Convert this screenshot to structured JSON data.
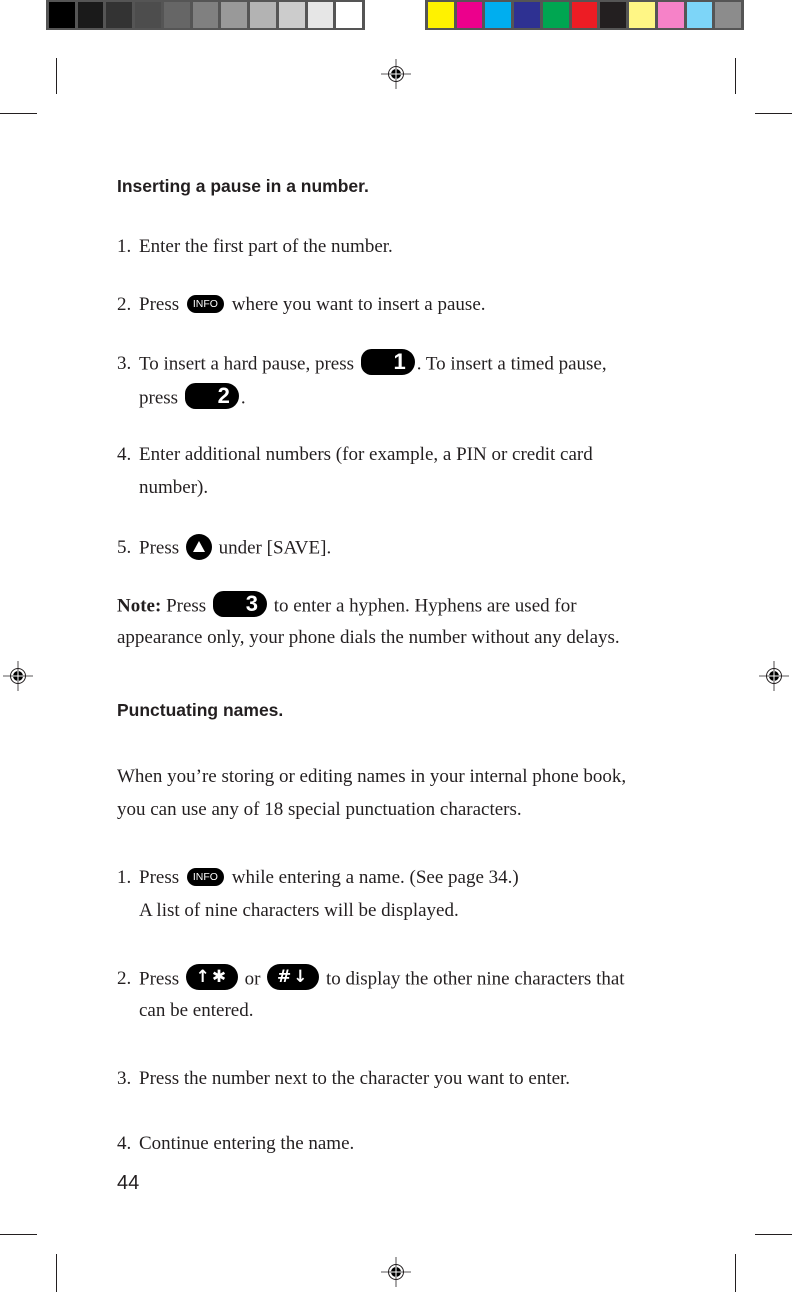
{
  "color_bars": {
    "grayscale": [
      "#000000",
      "#1a1a1a",
      "#333333",
      "#4d4d4d",
      "#666666",
      "#808080",
      "#999999",
      "#b3b3b3",
      "#cccccc",
      "#e6e6e6",
      "#ffffff"
    ],
    "process": [
      "#fff200",
      "#ec008c",
      "#00aeef",
      "#2e3192",
      "#00a651",
      "#ed1c24",
      "#231f20",
      "#fff685",
      "#f682c8",
      "#7dd5f8",
      "#8c8c8c"
    ]
  },
  "icons": {
    "registration_mark": "registration-mark",
    "info_key": "INFO",
    "key_1": "1",
    "key_2": "2",
    "key_3": "3",
    "up_softkey": "up-triangle",
    "star_key": "↑✱",
    "pound_key": "#↓"
  },
  "section1": {
    "heading": "Inserting a pause in a number.",
    "steps": [
      {
        "num": "1.",
        "text": "Enter the first part of the number."
      },
      {
        "num": "2.",
        "pre": "Press",
        "post": "where you want to insert a pause."
      },
      {
        "num": "3.",
        "pre": "To insert a hard pause, press",
        "mid": ". To insert a timed pause,",
        "line2_pre": "press",
        "line2_post": "."
      },
      {
        "num": "4.",
        "text": "Enter additional numbers (for example, a PIN or credit card",
        "line2": "number)."
      },
      {
        "num": "5.",
        "pre": "Press",
        "post": "under [SAVE]."
      }
    ],
    "note": {
      "label": "Note:",
      "pre": "Press",
      "post": "to enter a hyphen. Hyphens are used for",
      "line2": "appearance only, your phone dials the number without any delays."
    }
  },
  "section2": {
    "heading": "Punctuating names.",
    "intro_line1": "When you’re storing or editing names in your internal phone book,",
    "intro_line2": "you can use any of 18 special punctuation characters.",
    "steps": [
      {
        "num": "1.",
        "pre": "Press",
        "post": "while entering a name. (See page 34.)",
        "line2": "A list of nine characters will be displayed."
      },
      {
        "num": "2.",
        "pre": "Press",
        "mid": "or",
        "post": "to display the other nine characters that",
        "line2": "can be entered."
      },
      {
        "num": "3.",
        "text": "Press the number next to the character you want to enter."
      },
      {
        "num": "4.",
        "text": "Continue entering the name."
      }
    ]
  },
  "page_number": "44"
}
